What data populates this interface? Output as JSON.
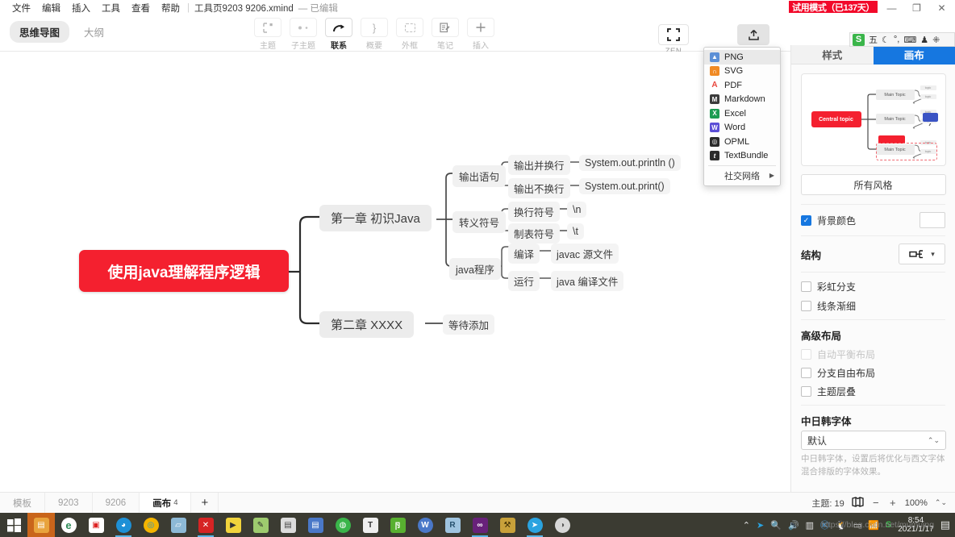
{
  "menubar": {
    "items": [
      "文件",
      "编辑",
      "插入",
      "工具",
      "查看",
      "帮助"
    ],
    "doc_title": "工具页9203 9206.xmind",
    "doc_state": "— 已编辑"
  },
  "window": {
    "trial_badge": "试用模式（已137天）",
    "minimize": "—",
    "maximize": "❐",
    "close": "✕"
  },
  "toolbar": {
    "view_tabs": [
      {
        "label": "思维导图",
        "active": true
      },
      {
        "label": "大纲",
        "active": false
      }
    ],
    "buttons": [
      {
        "label": "主题",
        "icon": "topic-icon",
        "enabled": false
      },
      {
        "label": "子主题",
        "icon": "subtopic-icon",
        "enabled": false
      },
      {
        "label": "联系",
        "icon": "relationship-icon",
        "enabled": true
      },
      {
        "label": "概要",
        "icon": "summary-icon",
        "enabled": false
      },
      {
        "label": "外框",
        "icon": "boundary-icon",
        "enabled": false
      },
      {
        "label": "笔记",
        "icon": "notes-icon",
        "enabled": false
      },
      {
        "label": "插入",
        "icon": "insert-plus-icon",
        "enabled": false
      }
    ],
    "zen_label": "ZEN",
    "share_label": "分享",
    "emoji_icon": "smiley-icon",
    "pin_icon": "pin-icon"
  },
  "ime": {
    "logo": "S",
    "items": [
      "五",
      "☾",
      "°,",
      "⌨",
      "♟",
      "⁜"
    ]
  },
  "export_menu": {
    "items": [
      {
        "label": "PNG",
        "icon": "png-icon",
        "color": "#5b8fd6",
        "glyph": "▲",
        "hover": true
      },
      {
        "label": "SVG",
        "icon": "svg-icon",
        "color": "#f08a24",
        "glyph": "∩",
        "hover": false
      },
      {
        "label": "PDF",
        "icon": "pdf-icon",
        "color": "#e8453c",
        "glyph": "A",
        "hover": false
      },
      {
        "label": "Markdown",
        "icon": "markdown-icon",
        "color": "#3b3b3b",
        "glyph": "M",
        "hover": false
      },
      {
        "label": "Excel",
        "icon": "excel-icon",
        "color": "#1d9c52",
        "glyph": "X",
        "hover": false
      },
      {
        "label": "Word",
        "icon": "word-icon",
        "color": "#5b4ed6",
        "glyph": "W",
        "hover": false
      },
      {
        "label": "OPML",
        "icon": "opml-icon",
        "color": "#2b2b2b",
        "glyph": "◎",
        "hover": false
      },
      {
        "label": "TextBundle",
        "icon": "textbundle-icon",
        "color": "#2b2b2b",
        "glyph": "t",
        "hover": false
      }
    ],
    "submenu": {
      "label": "社交网络",
      "arrow": "▶"
    }
  },
  "mindmap": {
    "root": "使用java理解程序逻辑",
    "branches": [
      {
        "label": "第一章 初识Java",
        "children": [
          {
            "label": "输出语句",
            "children": [
              {
                "label": "输出并换行",
                "value": "System.out.println ()"
              },
              {
                "label": "输出不换行",
                "value": "System.out.print()"
              }
            ]
          },
          {
            "label": "转义符号",
            "children": [
              {
                "label": "换行符号",
                "value": "\\n"
              },
              {
                "label": "制表符号",
                "value": "\\t"
              }
            ]
          },
          {
            "label": "java程序",
            "children": [
              {
                "label": "编译",
                "value": "javac 源文件"
              },
              {
                "label": "运行",
                "value": "java 编译文件"
              }
            ]
          }
        ]
      },
      {
        "label": "第二章 XXXX",
        "children": [
          {
            "label": "等待添加",
            "children": []
          }
        ]
      }
    ]
  },
  "panel": {
    "tabs": [
      {
        "label": "样式",
        "active": false
      },
      {
        "label": "画布",
        "active": true
      }
    ],
    "preview": {
      "central": "Central topic",
      "main_topics": [
        "Main Topic",
        "Main Topic",
        "Main Topic"
      ],
      "sub_topics": [
        "topic",
        "topic"
      ]
    },
    "all_styles": "所有风格",
    "background_color": {
      "label": "背景颜色",
      "checked": true,
      "swatch": "#ffffff"
    },
    "structure": {
      "title": "结构",
      "icon": "structure-logic-right-icon"
    },
    "options": [
      {
        "label": "彩虹分支",
        "checked": false,
        "disabled": false
      },
      {
        "label": "线条渐细",
        "checked": false,
        "disabled": false
      }
    ],
    "advanced": {
      "title": "高级布局",
      "options": [
        {
          "label": "自动平衡布局",
          "checked": false,
          "disabled": true
        },
        {
          "label": "分支自由布局",
          "checked": false,
          "disabled": false
        },
        {
          "label": "主题层叠",
          "checked": false,
          "disabled": false
        }
      ]
    },
    "cjk_font": {
      "title": "中日韩字体",
      "value": "默认",
      "help": "中日韩字体，设置后将优化与西文字体混合排版的字体效果。"
    }
  },
  "sheetbar": {
    "sheets": [
      {
        "label": "模板",
        "active": false,
        "count": ""
      },
      {
        "label": "9203",
        "active": false,
        "count": ""
      },
      {
        "label": "9206",
        "active": false,
        "count": ""
      },
      {
        "label": "画布",
        "active": true,
        "count": "4"
      }
    ],
    "add_label": "+",
    "topic_count": "主题: 19",
    "map_icon": "map-icon",
    "zoom_out": "−",
    "zoom_in": "+",
    "zoom_level": "100%",
    "zoom_stepper": "⌃⌄"
  },
  "taskbar": {
    "start_icon": "windows-start-icon",
    "apps": [
      {
        "name": "file-explorer-icon",
        "glyph": "🗂",
        "color": "#e8a33d",
        "active": true,
        "running": false
      },
      {
        "name": "edge-browser-icon",
        "glyph": "e",
        "color": "#2e8b57",
        "active": false,
        "running": false
      },
      {
        "name": "pdf-reader-icon",
        "glyph": "▣",
        "color": "#d22",
        "active": false,
        "running": false
      },
      {
        "name": "qq-browser-icon",
        "glyph": "◕",
        "color": "#1e90d6",
        "active": false,
        "running": true
      },
      {
        "name": "chrome-browser-icon",
        "glyph": "◎",
        "color": "#f4b400",
        "active": false,
        "running": false
      },
      {
        "name": "onenote-icon",
        "glyph": "▱",
        "color": "#8db9d6",
        "active": false,
        "running": false
      },
      {
        "name": "xmind-icon",
        "glyph": "✕",
        "color": "#d62424",
        "active": false,
        "running": true
      },
      {
        "name": "potplayer-icon",
        "glyph": "▶",
        "color": "#f2d43c",
        "active": false,
        "running": false
      },
      {
        "name": "photo-editor-icon",
        "glyph": "✎",
        "color": "#9ecb6e",
        "active": false,
        "running": false
      },
      {
        "name": "text-editor-icon",
        "glyph": "▤",
        "color": "#dcdcdc",
        "active": false,
        "running": false
      },
      {
        "name": "notepad-icon",
        "glyph": "▤",
        "color": "#4a78c8",
        "active": false,
        "running": false
      },
      {
        "name": "wechat-icon",
        "glyph": "◍",
        "color": "#3ab54a",
        "active": false,
        "running": false
      },
      {
        "name": "typora-icon",
        "glyph": "T",
        "color": "#e6e6e6",
        "active": false,
        "running": false
      },
      {
        "name": "office-app-icon",
        "glyph": "卪",
        "color": "#58b030",
        "active": false,
        "running": false
      },
      {
        "name": "wps-icon",
        "glyph": "W",
        "color": "#4a78c8",
        "active": false,
        "running": false
      },
      {
        "name": "resource-app-icon",
        "glyph": "R",
        "color": "#9fc4e0",
        "active": false,
        "running": false
      },
      {
        "name": "visual-studio-icon",
        "glyph": "∞",
        "color": "#68217a",
        "active": false,
        "running": true
      },
      {
        "name": "build-tools-icon",
        "glyph": "🛠",
        "color": "#c8a13a",
        "active": false,
        "running": false
      },
      {
        "name": "telegram-icon",
        "glyph": "➤",
        "color": "#2aa3e0",
        "active": false,
        "running": true
      },
      {
        "name": "clover-icon",
        "glyph": "◑",
        "color": "#d8d8d8",
        "active": false,
        "running": false
      }
    ],
    "tray": {
      "chevron": "⌃",
      "icons": [
        "➤",
        "🔍",
        "🔊",
        "▥",
        "Ⓚ",
        "🐧",
        "▭",
        "📶",
        "S"
      ],
      "time": "8:54",
      "date": "2021/1/17",
      "notification_icon": "notification-icon"
    }
  },
  "watermark": "https://blog.csdn.net/mumuing"
}
